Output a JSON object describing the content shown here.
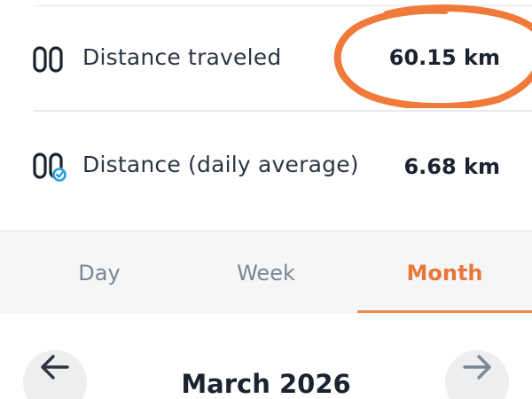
{
  "stats": [
    {
      "label": "Distance traveled",
      "value": "60.15 km",
      "icon": "footprints-icon"
    },
    {
      "label": "Distance (daily average)",
      "value": "6.68 km",
      "icon": "footprints-average-icon"
    }
  ],
  "tabs": {
    "day": "Day",
    "week": "Week",
    "month": "Month",
    "active": "month"
  },
  "navigator": {
    "period": "March 2026",
    "prev_icon": "arrow-left-icon",
    "next_icon": "arrow-right-icon"
  },
  "colors": {
    "accent": "#e8783a",
    "highlight_circle": "#f07a3a",
    "badge_blue": "#2b9be0",
    "tab_bar_bg": "#f5f6f7",
    "text_primary": "#1c2330",
    "text_muted": "#7c8694"
  }
}
